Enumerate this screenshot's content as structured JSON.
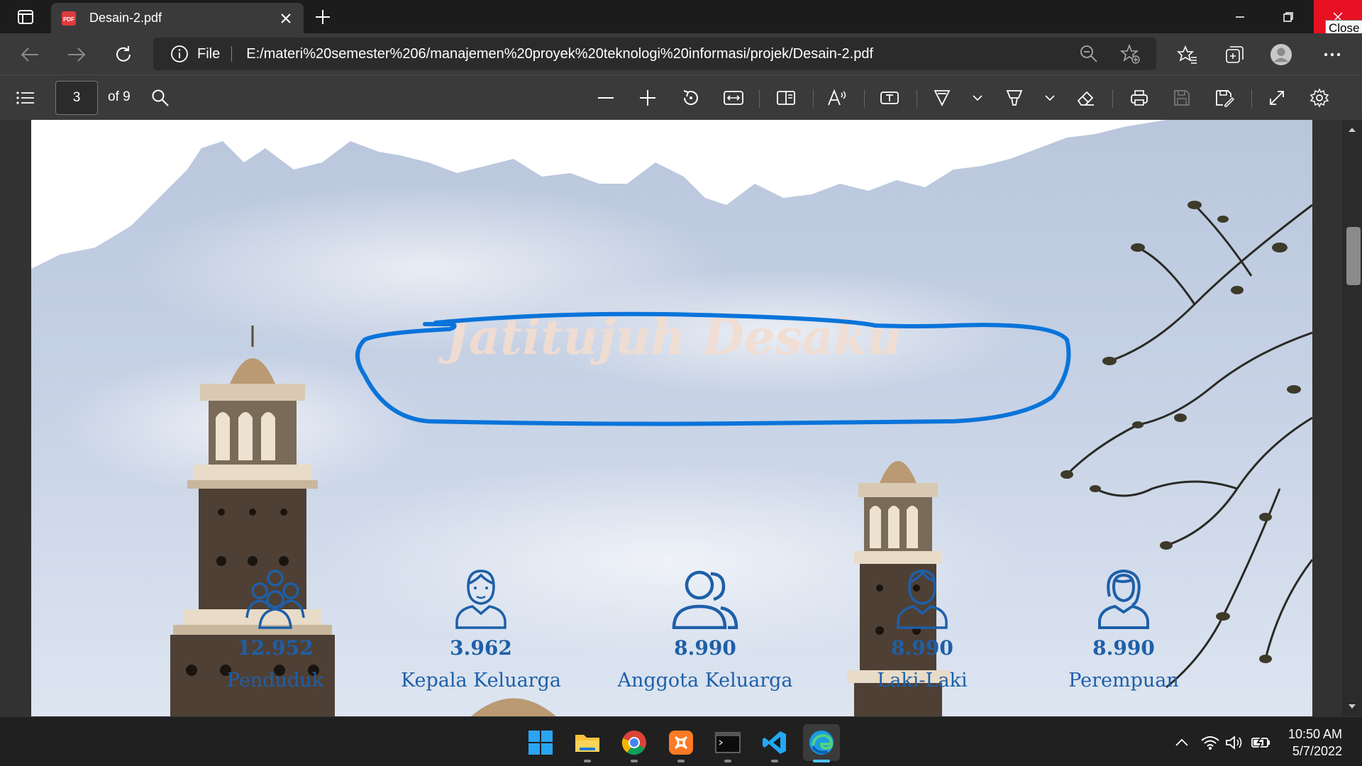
{
  "browser": {
    "tab_title": "Desain-2.pdf",
    "close_tooltip": "Close",
    "address_scheme": "File",
    "address_url": "E:/materi%20semester%206/manajemen%20proyek%20teknologi%20informasi/projek/Desain-2.pdf"
  },
  "pdf_toolbar": {
    "current_page": "3",
    "total_pages_label": "of 9"
  },
  "document": {
    "heading": "Jatitujuh Desaku",
    "stats": [
      {
        "value": "12.952",
        "label": "Penduduk",
        "icon": "people-group-icon"
      },
      {
        "value": "3.962",
        "label": "Kepala Keluarga",
        "icon": "man-icon"
      },
      {
        "value": "8.990",
        "label": "Anggota Keluarga",
        "icon": "two-people-icon"
      },
      {
        "value": "8.990",
        "label": "Laki-Laki",
        "icon": "male-icon"
      },
      {
        "value": "8.990",
        "label": "Perempuan",
        "icon": "female-icon"
      }
    ],
    "colors": {
      "stat_text": "#1e5fa8",
      "ink_annotation": "#0a74da",
      "heading": "#f3ddd0"
    }
  },
  "taskbar": {
    "apps": [
      "windows-start-icon",
      "file-explorer-icon",
      "chrome-icon",
      "xampp-icon",
      "terminal-icon",
      "vscode-icon",
      "edge-icon"
    ],
    "time": "10:50 AM",
    "date": "5/7/2022"
  }
}
